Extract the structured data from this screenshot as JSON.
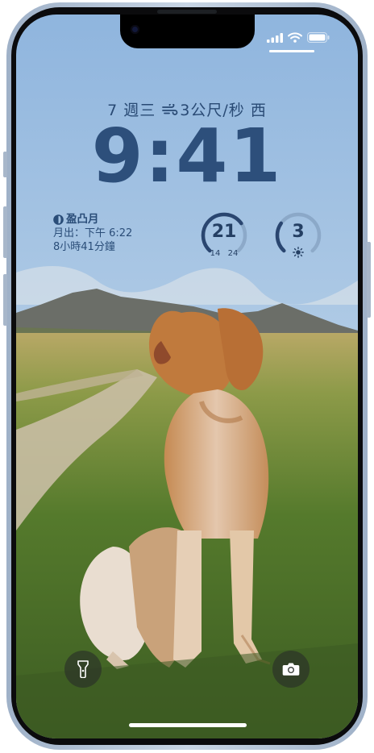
{
  "lock_screen": {
    "date": "7 週三",
    "wind": "3公尺/秒 西",
    "time": "9:41",
    "moon": {
      "title": "盈凸月",
      "rise_label": "月出：下午 6:22",
      "duration": "8小時41分鐘"
    },
    "temperature": {
      "current": "21",
      "low": "14",
      "high": "24",
      "level": 0.7
    },
    "uv": {
      "value": "3",
      "level": 0.3
    },
    "icons": {
      "flashlight": "flashlight-icon",
      "camera": "camera-icon",
      "moon": "moon-icon",
      "wind": "wind-icon",
      "sun": "sun-icon"
    }
  },
  "colors": {
    "clock": "#2d4f7b",
    "widget_text": "#243f63",
    "sky": "#a9c6e4",
    "grass": "#5a7a2c"
  }
}
